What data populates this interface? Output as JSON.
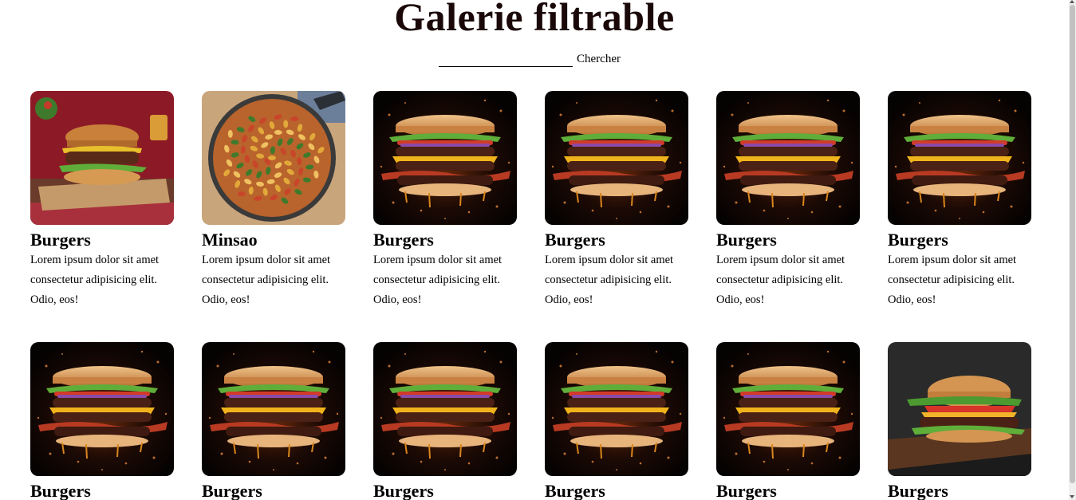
{
  "page_title": "Galerie filtrable",
  "search": {
    "placeholder": "",
    "button_label": "Chercher"
  },
  "cards": [
    {
      "title": "Burgers",
      "text": "Lorem ipsum dolor sit amet consectetur adipisicing elit. Odio, eos!",
      "image": "burger-board-image"
    },
    {
      "title": "Minsao",
      "text": "Lorem ipsum dolor sit amet consectetur adipisicing elit. Odio, eos!",
      "image": "pasta-pan-image"
    },
    {
      "title": "Burgers",
      "text": "Lorem ipsum dolor sit amet consectetur adipisicing elit. Odio, eos!",
      "image": "stacked-burger-image"
    },
    {
      "title": "Burgers",
      "text": "Lorem ipsum dolor sit amet consectetur adipisicing elit. Odio, eos!",
      "image": "stacked-burger-image"
    },
    {
      "title": "Burgers",
      "text": "Lorem ipsum dolor sit amet consectetur adipisicing elit. Odio, eos!",
      "image": "stacked-burger-image"
    },
    {
      "title": "Burgers",
      "text": "Lorem ipsum dolor sit amet consectetur adipisicing elit. Odio, eos!",
      "image": "stacked-burger-image"
    },
    {
      "title": "Burgers",
      "text": "",
      "image": "stacked-burger-image"
    },
    {
      "title": "Burgers",
      "text": "",
      "image": "stacked-burger-image"
    },
    {
      "title": "Burgers",
      "text": "",
      "image": "stacked-burger-image"
    },
    {
      "title": "Burgers",
      "text": "",
      "image": "stacked-burger-image"
    },
    {
      "title": "Burgers",
      "text": "",
      "image": "stacked-burger-image"
    },
    {
      "title": "Burgers",
      "text": "",
      "image": "classic-burger-image"
    }
  ],
  "colors": {
    "title": "#1a0808",
    "background": "#ffffff",
    "scrollbar_thumb": "#c1c1c1"
  }
}
